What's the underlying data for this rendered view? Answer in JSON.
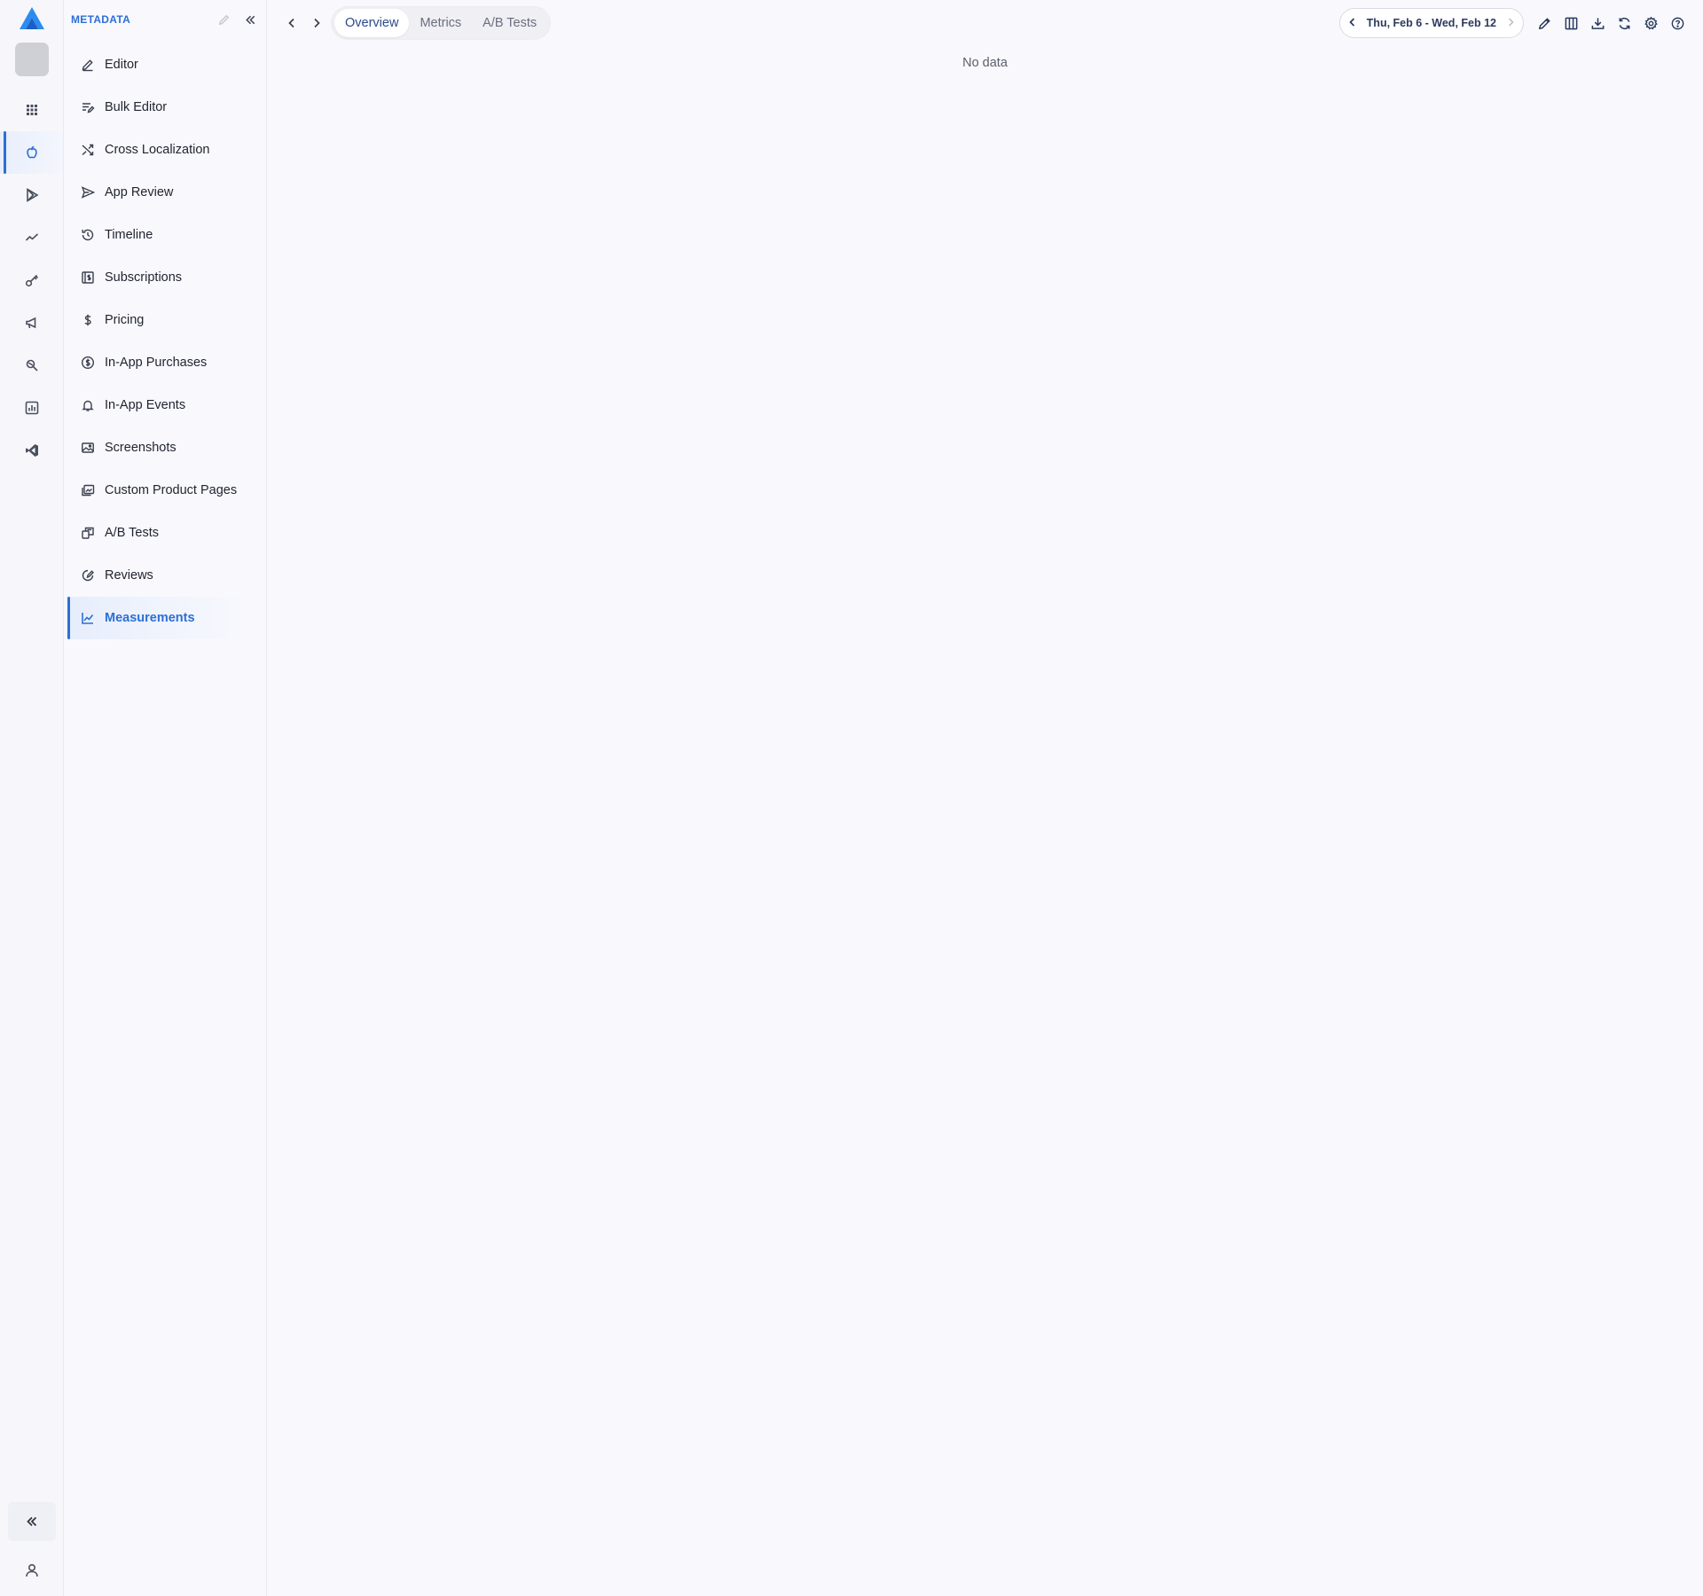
{
  "sidebar": {
    "title": "METADATA",
    "items": [
      {
        "label": "Editor",
        "icon": "pencil-icon"
      },
      {
        "label": "Bulk Editor",
        "icon": "bulk-edit-icon"
      },
      {
        "label": "Cross Localization",
        "icon": "shuffle-icon"
      },
      {
        "label": "App Review",
        "icon": "send-icon"
      },
      {
        "label": "Timeline",
        "icon": "history-icon"
      },
      {
        "label": "Subscriptions",
        "icon": "subscription-icon"
      },
      {
        "label": "Pricing",
        "icon": "dollar-icon"
      },
      {
        "label": "In-App Purchases",
        "icon": "coin-icon"
      },
      {
        "label": "In-App Events",
        "icon": "bell-icon"
      },
      {
        "label": "Screenshots",
        "icon": "image-icon"
      },
      {
        "label": "Custom Product Pages",
        "icon": "pages-icon"
      },
      {
        "label": "A/B Tests",
        "icon": "ab-test-icon"
      },
      {
        "label": "Reviews",
        "icon": "review-icon"
      },
      {
        "label": "Measurements",
        "icon": "chart-line-icon",
        "active": true
      }
    ]
  },
  "tabs": [
    {
      "label": "Overview",
      "active": true
    },
    {
      "label": "Metrics"
    },
    {
      "label": "A/B Tests"
    }
  ],
  "date_range": {
    "label": "Thu, Feb 6 - Wed, Feb 12"
  },
  "main": {
    "empty_text": "No data"
  },
  "colors": {
    "accent": "#2d6fd6",
    "background": "#f9f9fd",
    "text": "#1f2330"
  }
}
